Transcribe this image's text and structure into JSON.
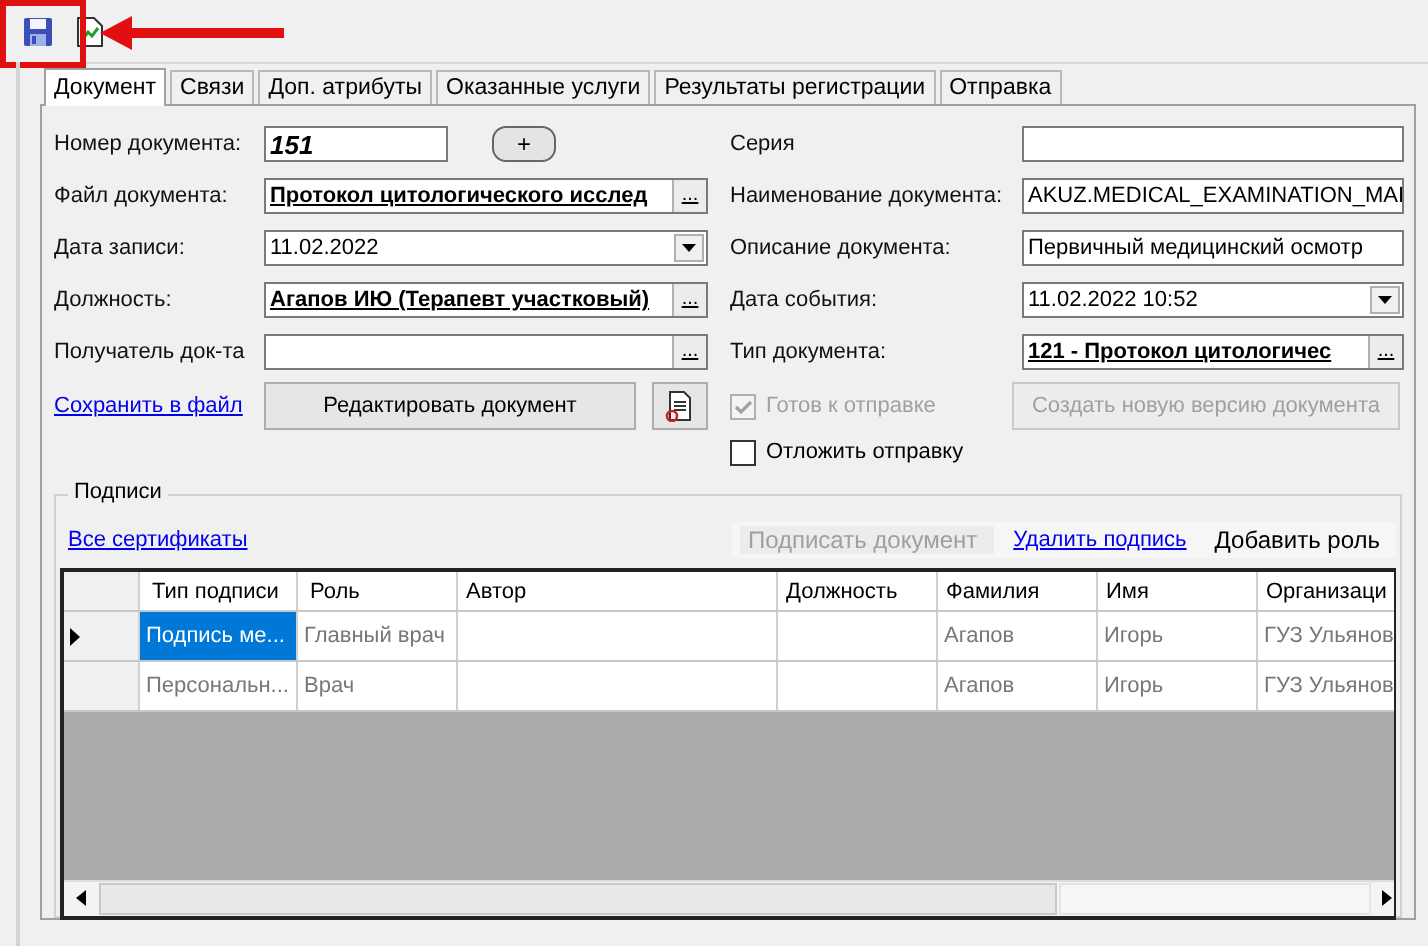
{
  "tabs": [
    {
      "label": "Документ",
      "selected": true
    },
    {
      "label": "Связи",
      "selected": false
    },
    {
      "label": "Доп. атрибуты",
      "selected": false
    },
    {
      "label": "Оказанные услуги",
      "selected": false
    },
    {
      "label": "Результаты регистрации",
      "selected": false
    },
    {
      "label": "Отправка",
      "selected": false
    }
  ],
  "left_fields": [
    {
      "kind": "number",
      "label": "Номер документа:",
      "value": "151",
      "add_button": "+"
    },
    {
      "kind": "lookup",
      "label": "Файл документа:",
      "value": "Протокол цитологического исслед",
      "browse_button": "..."
    },
    {
      "kind": "date",
      "label": "Дата записи:",
      "value": "11.02.2022"
    },
    {
      "kind": "lookup",
      "label": "Должность:",
      "value": "Агапов ИЮ (Терапевт участковый)",
      "browse_button": "..."
    },
    {
      "kind": "lookup",
      "label": "Получатель док-та",
      "browse_button": "..."
    }
  ],
  "right_fields": [
    {
      "kind": "text",
      "label": "Серия"
    },
    {
      "kind": "text",
      "label": "Наименование документа:",
      "value": "AKUZ.MEDICAL_EXAMINATION_MAI"
    },
    {
      "kind": "text",
      "label": "Описание документа:",
      "value": "Первичный медицинский осмотр"
    },
    {
      "kind": "date",
      "label": "Дата события:",
      "value": "11.02.2022 10:52"
    },
    {
      "kind": "lookup",
      "label": "Тип документа:",
      "value": "121 - Протокол цитологичес",
      "browse_button": "..."
    }
  ],
  "save_link": "Сохранить в файл",
  "edit_button": "Редактировать документ",
  "ready_checkbox": {
    "label": "Готов к отправке",
    "checked": true,
    "disabled": true
  },
  "new_version_button": {
    "label": "Создать новую версию документа",
    "disabled": true
  },
  "postpone_checkbox": {
    "label": "Отложить отправку",
    "checked": false,
    "disabled": false
  },
  "signatures": {
    "title": "Подписи",
    "certificates_link": "Все сертификаты",
    "actions": [
      {
        "kind": "button",
        "label": "Подписать документ",
        "disabled": true
      },
      {
        "kind": "link",
        "label": "Удалить подпись",
        "disabled": false
      },
      {
        "kind": "button",
        "label": "Добавить роль",
        "disabled": false
      }
    ],
    "columns": [
      "Тип подписи",
      "Роль",
      "Автор",
      "Должность",
      "Фамилия",
      "Имя",
      "Организаци"
    ],
    "rows": [
      {
        "selected": true,
        "cells": [
          "Подпись ме...",
          "Главный врач",
          null,
          null,
          "Агапов",
          "Игорь",
          "ГУЗ Ульянов"
        ]
      },
      {
        "selected": false,
        "cells": [
          "Персональн...",
          "Врач",
          null,
          null,
          "Агапов",
          "Игорь",
          "ГУЗ Ульянов"
        ]
      }
    ]
  }
}
